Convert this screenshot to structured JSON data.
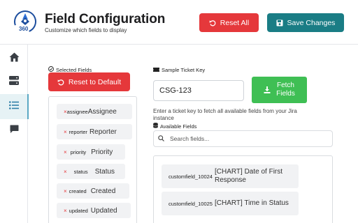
{
  "header": {
    "logo_text": "360",
    "title": "Field Configuration",
    "subtitle": "Customize which fields to display",
    "reset_all_label": "Reset All",
    "save_label": "Save Changes"
  },
  "sidebar": {
    "items": [
      {
        "icon": "home-icon",
        "active": false
      },
      {
        "icon": "server-icon",
        "active": false
      },
      {
        "icon": "list-icon",
        "active": true
      },
      {
        "icon": "chat-icon",
        "active": false
      }
    ]
  },
  "selected": {
    "label": "Selected Fields",
    "reset_default_label": "Reset to Default",
    "fields": [
      {
        "id": "assignee",
        "name": "Assignee"
      },
      {
        "id": "reporter",
        "name": "Reporter"
      },
      {
        "id": "priority",
        "name": "Priority"
      },
      {
        "id": "status",
        "name": "Status"
      },
      {
        "id": "created",
        "name": "Created"
      },
      {
        "id": "updated",
        "name": "Updated"
      }
    ],
    "remove_glyph": "×"
  },
  "ticket": {
    "label": "Sample Ticket Key",
    "value": "CSG-123",
    "fetch_label_line1": "Fetch",
    "fetch_label_line2": "Fields",
    "hint": "Enter a ticket key to fetch all available fields from your Jira instance"
  },
  "available": {
    "label": "Available Fields",
    "search_placeholder": "Search fields...",
    "fields": [
      {
        "id": "customfield_10024",
        "name": "[CHART] Date of First Response"
      },
      {
        "id": "customfield_10025",
        "name": "[CHART] Time in Status"
      }
    ]
  },
  "colors": {
    "danger": "#e5383b",
    "teal": "#1a7d85",
    "success": "#3fbf54",
    "active_bg": "#e6f2f5"
  }
}
